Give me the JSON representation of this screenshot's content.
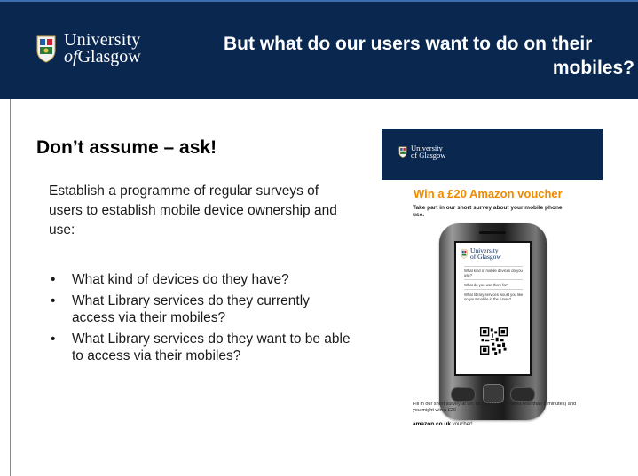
{
  "header": {
    "logo": {
      "line1": "University",
      "line2_prefix": "of",
      "line2_rest": "Glasgow"
    },
    "title_line1": "But what do our users want to do on their",
    "title_line2": "mobiles?"
  },
  "content": {
    "heading": "Don’t assume – ask!",
    "intro": "Establish a programme of regular surveys of users to establish mobile device ownership and use:",
    "bullets": [
      "What kind of devices do they have?",
      "What Library services do they currently access via their mobiles?",
      "What Library services do they want to be able to access via their mobiles?"
    ]
  },
  "poster": {
    "logo": {
      "line1": "University",
      "line2": "of Glasgow"
    },
    "title": "Win a £20 Amazon voucher",
    "subtitle": "Take part in our short survey about your mobile phone use.",
    "screen": {
      "logo": {
        "line1": "University",
        "line2": "of Glasgow"
      },
      "q1": "What kind of mobile devices do you use?",
      "q2": "What do you use them for?",
      "q3": "What library services would you like on your mobile in the future?"
    },
    "footer": "Fill in our short survey at url: bit.ly/icSQZ8 (it takes less than 5 minutes) and you might win a £20",
    "amazon_brand": "amazon.co.uk",
    "amazon_suffix": " voucher!"
  },
  "colors": {
    "header_bg": "#0a2750",
    "poster_title": "#f08a00"
  }
}
